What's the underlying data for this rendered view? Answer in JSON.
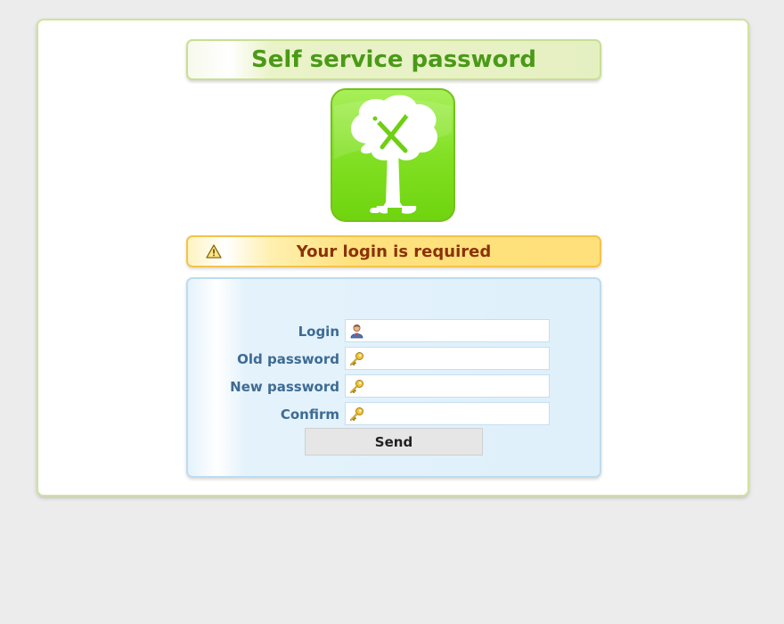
{
  "header": {
    "title": "Self service password"
  },
  "logo": {
    "icon": "tree-with-tools-logo",
    "color": "#7ad31a"
  },
  "alert": {
    "icon": "warning-icon",
    "message": "Your login is required",
    "color": "#8a3208"
  },
  "form": {
    "fields": [
      {
        "label": "Login",
        "icon": "user-icon",
        "value": "",
        "type": "text"
      },
      {
        "label": "Old password",
        "icon": "key-icon",
        "value": "",
        "type": "password"
      },
      {
        "label": "New password",
        "icon": "key-icon",
        "value": "",
        "type": "password"
      },
      {
        "label": "Confirm",
        "icon": "key-icon",
        "value": "",
        "type": "password"
      }
    ],
    "submit_label": "Send"
  },
  "colors": {
    "title_green": "#4a9a18",
    "label_blue": "#3e6b93",
    "page_background": "#ececec"
  }
}
